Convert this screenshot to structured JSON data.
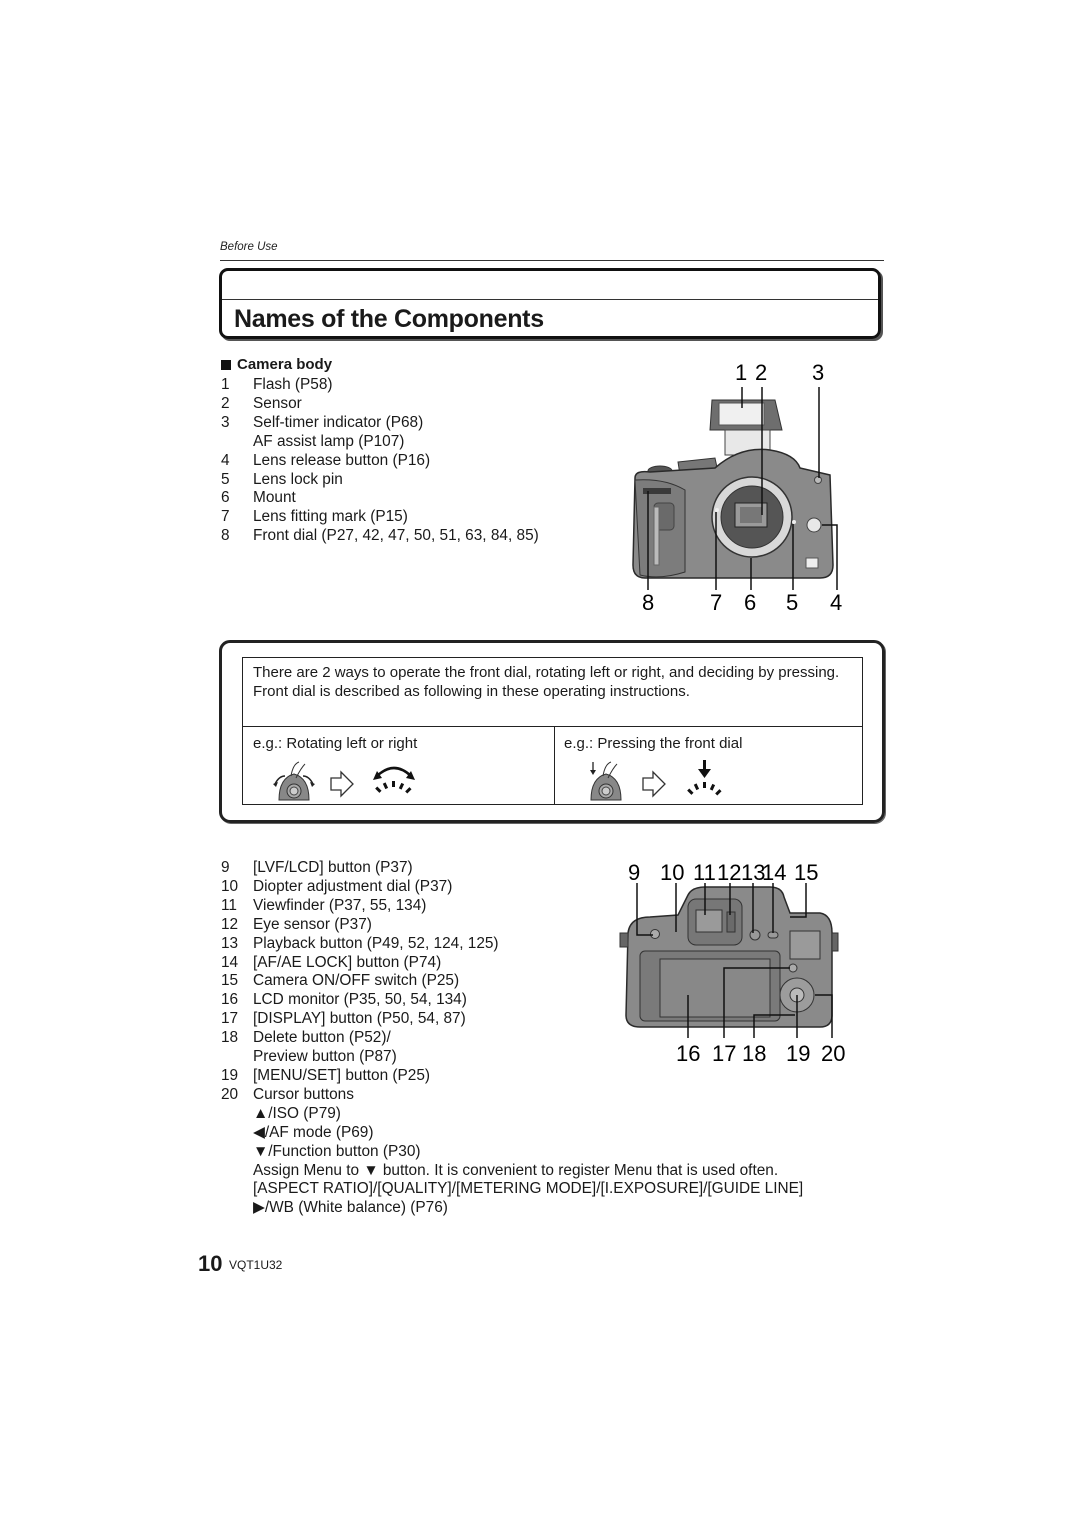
{
  "header": {
    "section": "Before Use",
    "title": "Names of the Components"
  },
  "camera_body": {
    "heading": "Camera body",
    "front_items": [
      {
        "num": "1",
        "text": "Flash (P58)"
      },
      {
        "num": "2",
        "text": "Sensor"
      },
      {
        "num": "3",
        "text": "Self-timer indicator (P68)",
        "extra": "AF assist lamp (P107)"
      },
      {
        "num": "4",
        "text": "Lens release button (P16)"
      },
      {
        "num": "5",
        "text": "Lens lock pin"
      },
      {
        "num": "6",
        "text": "Mount"
      },
      {
        "num": "7",
        "text": "Lens fitting mark (P15)"
      },
      {
        "num": "8",
        "text": "Front dial (P27, 42, 47, 50, 51, 63, 84, 85)"
      }
    ],
    "front_callouts": {
      "c1": "1",
      "c2": "2",
      "c3": "3",
      "c4": "4",
      "c5": "5",
      "c6": "6",
      "c7": "7",
      "c8": "8"
    }
  },
  "info_box": {
    "paragraph1": "There are 2 ways to operate the front dial, rotating left or right, and deciding by pressing.",
    "paragraph2": "Front dial is described as following in these operating instructions.",
    "left_label": "e.g.: Rotating left or right",
    "right_label": "e.g.: Pressing the front dial",
    "left_icons": [
      "dial-rotate-hand-icon",
      "arrow-right-outline-icon",
      "rotate-both-ways-icon"
    ],
    "right_icons": [
      "dial-press-hand-icon",
      "arrow-right-outline-icon",
      "press-down-icon"
    ]
  },
  "back_items": [
    {
      "num": "9",
      "text": "[LVF/LCD] button (P37)"
    },
    {
      "num": "10",
      "text": "Diopter adjustment dial (P37)"
    },
    {
      "num": "11",
      "text": "Viewfinder (P37, 55, 134)"
    },
    {
      "num": "12",
      "text": "Eye sensor (P37)"
    },
    {
      "num": "13",
      "text": "Playback button (P49, 52, 124, 125)"
    },
    {
      "num": "14",
      "text": "[AF/AE LOCK] button (P74)"
    },
    {
      "num": "15",
      "text": "Camera ON/OFF switch (P25)"
    },
    {
      "num": "16",
      "text": "LCD monitor (P35, 50, 54, 134)"
    },
    {
      "num": "17",
      "text": "[DISPLAY] button (P50, 54, 87)"
    },
    {
      "num": "18",
      "text": "Delete button (P52)/",
      "extra": "Preview button (P87)"
    },
    {
      "num": "19",
      "text": "[MENU/SET] button (P25)"
    },
    {
      "num": "20",
      "text": "Cursor buttons"
    }
  ],
  "cursor_buttons": [
    {
      "glyph": "▲",
      "text": "/ISO (P79)"
    },
    {
      "glyph": "◀",
      "text": "/AF mode (P69)"
    },
    {
      "glyph": "▼",
      "text": "/Function button (P30)"
    }
  ],
  "assign_note": "Assign Menu to ▼ button. It is convenient to register Menu that is used often.",
  "assign_menus": "[ASPECT RATIO]/[QUALITY]/[METERING MODE]/[I.EXPOSURE]/[GUIDE LINE]",
  "wb_item": {
    "glyph": "▶",
    "text": "/WB (White balance) (P76)"
  },
  "back_callouts": {
    "c9": "9",
    "c10": "10",
    "c11": "11",
    "c12": "12",
    "c13": "13",
    "c14": "14",
    "c15": "15",
    "c16": "16",
    "c17": "17",
    "c18": "18",
    "c19": "19",
    "c20": "20"
  },
  "footer": {
    "page": "10",
    "code": "VQT1U32"
  }
}
